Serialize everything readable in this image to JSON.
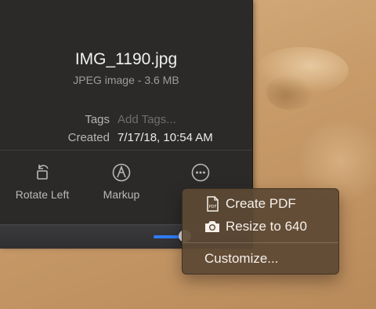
{
  "file": {
    "name": "IMG_1190.jpg",
    "kind": "JPEG image - 3.6 MB"
  },
  "metadata": {
    "tags_label": "Tags",
    "tags_placeholder": "Add Tags...",
    "created_label": "Created",
    "created_value": "7/17/18, 10:54 AM"
  },
  "actions": {
    "rotate_left": {
      "label": "Rotate Left",
      "icon": "rotate-left-icon"
    },
    "markup": {
      "label": "Markup",
      "icon": "markup-icon"
    },
    "more": {
      "label": "",
      "icon": "more-icon"
    }
  },
  "zoom_slider": {
    "value_percent": 100,
    "accent_color": "#2f7cf6"
  },
  "menu": {
    "items": [
      {
        "label": "Create PDF",
        "icon": "pdf-icon"
      },
      {
        "label": "Resize to 640",
        "icon": "camera-icon"
      },
      {
        "label": "Customize...",
        "icon": ""
      }
    ]
  }
}
